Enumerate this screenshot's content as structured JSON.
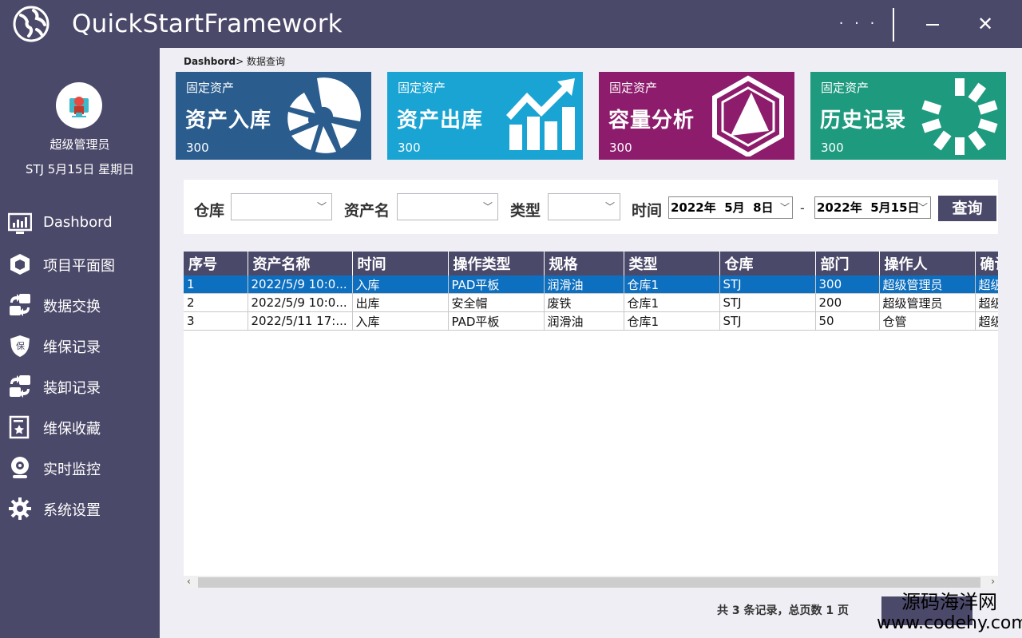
{
  "app": {
    "title": "QuickStartFramework",
    "more_label": "· · ·",
    "close_label": "✕"
  },
  "user": {
    "name": "超级管理员",
    "date": "STJ 5月15日 星期日"
  },
  "sidebar": {
    "items": [
      {
        "label": "Dashbord",
        "icon": "dashboard-icon"
      },
      {
        "label": "项目平面图",
        "icon": "cube-icon"
      },
      {
        "label": "数据交换",
        "icon": "exchange-icon"
      },
      {
        "label": "维保记录",
        "icon": "shield-icon"
      },
      {
        "label": "装卸记录",
        "icon": "load-icon"
      },
      {
        "label": "维保收藏",
        "icon": "bookmark-icon"
      },
      {
        "label": "实时监控",
        "icon": "webcam-icon"
      },
      {
        "label": "系统设置",
        "icon": "gear-icon"
      }
    ]
  },
  "breadcrumb": {
    "root": "Dashbord",
    "sep": ">",
    "current": " 数据查询"
  },
  "cards": [
    {
      "sub": "固定资产",
      "title": "资产入库",
      "value": "300",
      "color": "#2a5c8e",
      "icon": "pie-icon"
    },
    {
      "sub": "固定资产",
      "title": "资产出库",
      "value": "300",
      "color": "#1aa4d4",
      "icon": "growth-chart-icon"
    },
    {
      "sub": "固定资产",
      "title": "容量分析",
      "value": "300",
      "color": "#8d1c6c",
      "icon": "hexagon-icon"
    },
    {
      "sub": "固定资产",
      "title": "历史记录",
      "value": "300",
      "color": "#1e9a7e",
      "icon": "loading-icon"
    }
  ],
  "filter": {
    "warehouse_label": "仓库",
    "asset_label": "资产名",
    "type_label": "类型",
    "time_label": "时间",
    "date_from": "2022年  5月  8日",
    "date_to": "2022年  5月15日",
    "dash": "-",
    "query_label": "查询"
  },
  "table": {
    "columns": [
      "序号",
      "资产名称",
      "时间",
      "操作类型",
      "规格",
      "类型",
      "仓库",
      "部门",
      "操作人",
      "确认"
    ],
    "rows": [
      [
        "1",
        "2022/5/9 10:0...",
        "入库",
        "PAD平板",
        "润滑油",
        "仓库1",
        "STJ",
        "300",
        "超级管理员",
        "超级"
      ],
      [
        "2",
        "2022/5/9 10:0...",
        "出库",
        "安全帽",
        "废铁",
        "仓库1",
        "STJ",
        "200",
        "超级管理员",
        "超级"
      ],
      [
        "3",
        "2022/5/11 17:...",
        "入库",
        "PAD平板",
        "润滑油",
        "仓库1",
        "STJ",
        "50",
        "仓管",
        "超级"
      ]
    ]
  },
  "footer": {
    "status": "共 3 条记录，总页数 1 页"
  },
  "watermark": {
    "line1": "源码海洋网",
    "line2": "www.codehy.com"
  }
}
